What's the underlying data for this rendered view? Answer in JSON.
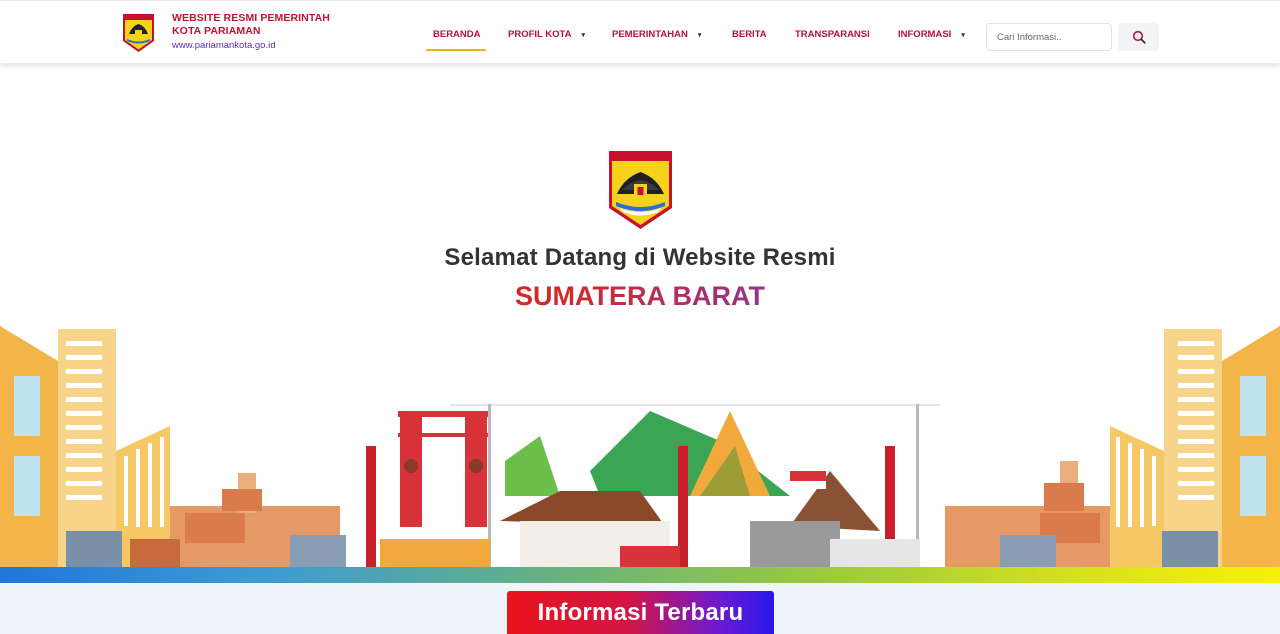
{
  "brand": {
    "line1": "WEBSITE RESMI PEMERINTAH",
    "line2": "KOTA PARIAMAN",
    "url": "www.pariamankota.go.id",
    "emblem_label": "KOTA PARIAMAN"
  },
  "nav": {
    "items": [
      {
        "label": "BERANDA",
        "active": true,
        "dropdown": false
      },
      {
        "label": "PROFIL KOTA",
        "active": false,
        "dropdown": true
      },
      {
        "label": "PEMERINTAHAN",
        "active": false,
        "dropdown": true
      },
      {
        "label": "BERITA",
        "active": false,
        "dropdown": false
      },
      {
        "label": "TRANSPARANSI",
        "active": false,
        "dropdown": false
      },
      {
        "label": "INFORMASI",
        "active": false,
        "dropdown": true
      }
    ],
    "caret": "▾"
  },
  "search": {
    "placeholder": "Cari Informasi..",
    "icon": "search-icon"
  },
  "hero": {
    "title": "Selamat Datang di Website Resmi",
    "subtitle": "SUMATERA BARAT"
  },
  "section": {
    "badge": "Informasi Terbaru"
  },
  "colors": {
    "nav_text": "#b5123c",
    "active_underline": "#f0b400",
    "badge_start": "#e8141c",
    "badge_end": "#2a18e8"
  }
}
